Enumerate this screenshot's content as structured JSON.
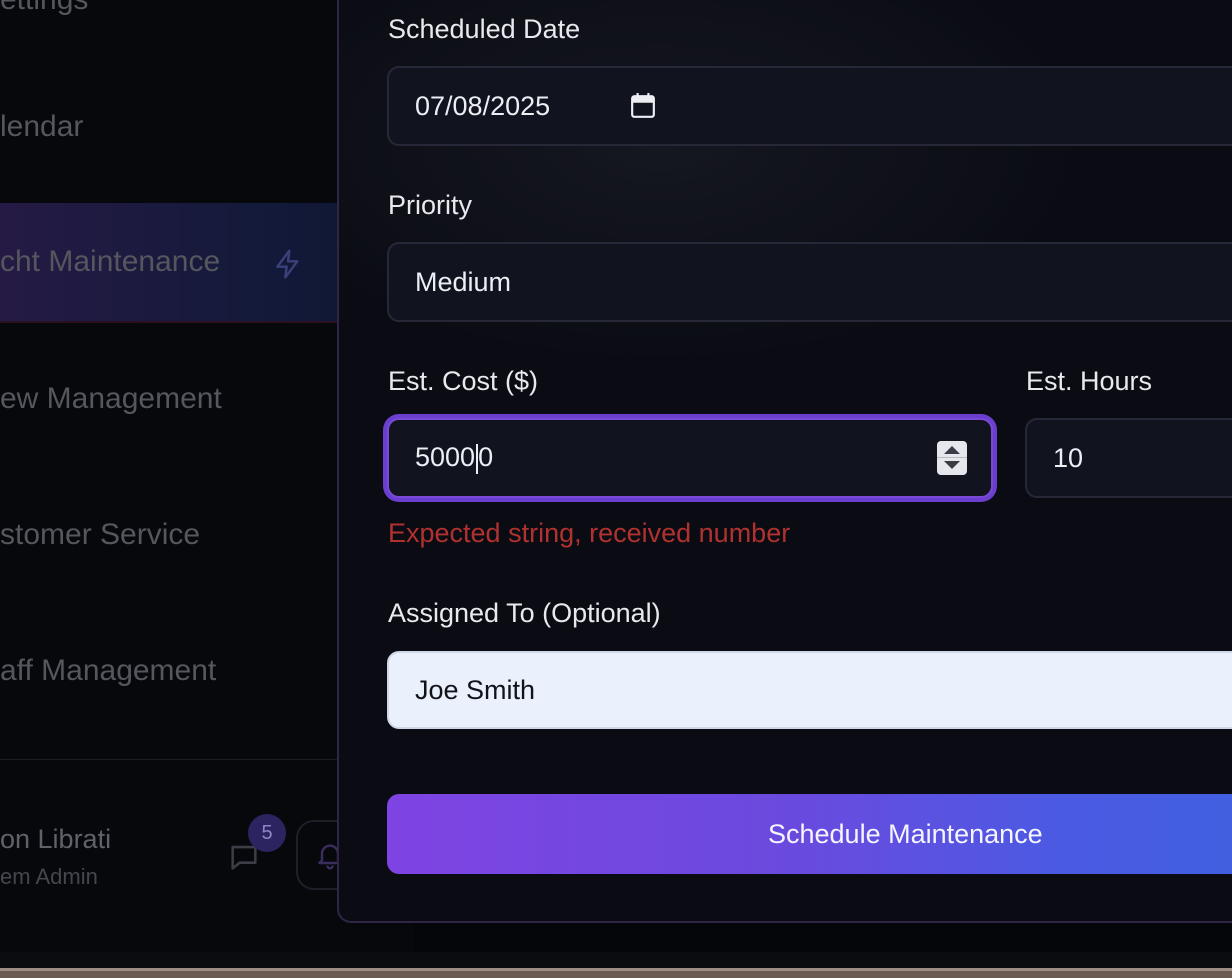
{
  "sidebar": {
    "items": [
      {
        "label": "ettings",
        "active": false
      },
      {
        "label": "lendar",
        "active": false
      },
      {
        "label": "cht Maintenance",
        "active": true,
        "icon": "bolt-icon"
      },
      {
        "label": "ew Management",
        "active": false
      },
      {
        "label": "stomer Service",
        "active": false
      },
      {
        "label": "aff Management",
        "active": false
      }
    ],
    "user": {
      "name": "on Librati",
      "role": "em Admin"
    },
    "messages_badge": "5",
    "icons": [
      "chat-icon",
      "bell-icon"
    ]
  },
  "form": {
    "scheduled_date": {
      "label": "Scheduled Date",
      "value": "07/08/2025",
      "icon": "calendar-icon"
    },
    "priority": {
      "label": "Priority",
      "value": "Medium"
    },
    "est_cost": {
      "label": "Est. Cost ($)",
      "value_before_caret": "5000",
      "value_after_caret": "0",
      "error": "Expected string, received number"
    },
    "est_hours": {
      "label": "Est. Hours",
      "value": "10"
    },
    "assigned_to": {
      "label": "Assigned To (Optional)",
      "value": "Joe Smith"
    },
    "submit_label": "Schedule Maintenance"
  },
  "colors": {
    "accent": "#7a4ad6",
    "error": "#b0322f",
    "button_gradient_start": "#7f44e3",
    "button_gradient_end": "#3f61e0"
  }
}
